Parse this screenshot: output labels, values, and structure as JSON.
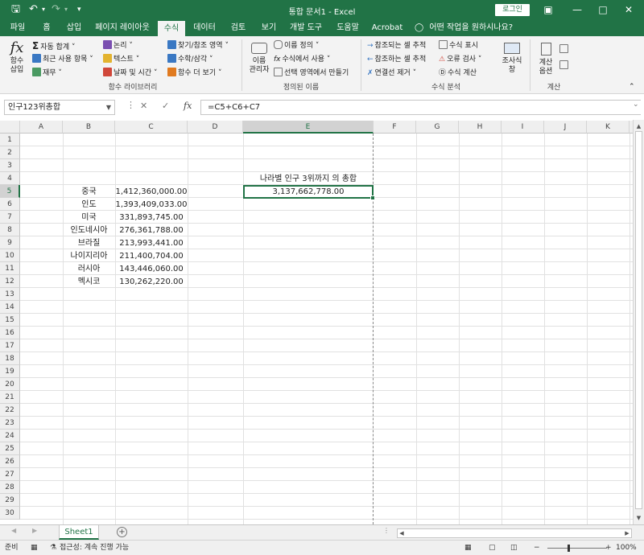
{
  "titlebar": {
    "save_icon": "save-icon",
    "undo_icon": "undo-icon",
    "redo_icon": "redo-icon",
    "title": "통합 문서1  -  Excel",
    "login_label": "로그인"
  },
  "tabs": [
    "파일",
    "홈",
    "삽입",
    "페이지 레이아웃",
    "수식",
    "데이터",
    "검토",
    "보기",
    "개발 도구",
    "도움말",
    "Acrobat"
  ],
  "active_tab": "수식",
  "help_text": "어떤 작업을 원하시나요?",
  "ribbon": {
    "insert_function": {
      "line1": "함수",
      "line2": "삽입"
    },
    "library": {
      "autosum": "자동 합계",
      "recent": "최근 사용 항목",
      "financial": "재무",
      "logical": "논리",
      "text": "텍스트",
      "datetime": "날짜 및 시간",
      "lookup": "찾기/참조 영역",
      "math": "수학/삼각",
      "more": "함수 더 보기",
      "group_label": "함수 라이브러리"
    },
    "names": {
      "manager_line1": "이름",
      "manager_line2": "관리자",
      "define": "이름 정의",
      "use": "수식에서 사용",
      "create": "선택 영역에서 만들기",
      "group_label": "정의된 이름"
    },
    "audit": {
      "precedents": "참조되는 셀 추적",
      "dependents": "참조하는 셀 추적",
      "remove": "연결선 제거",
      "show": "수식 표시",
      "error": "오류 검사",
      "evaluate": "수식 계산",
      "watch_line1": "조사식",
      "watch_line2": "창",
      "group_label": "수식 분석"
    },
    "calc": {
      "options_line1": "계산",
      "options_line2": "옵션",
      "group_label": "계산"
    }
  },
  "formula_bar": {
    "name_box": "인구123위총합",
    "formula": "=C5+C6+C7"
  },
  "columns": [
    "A",
    "B",
    "C",
    "D",
    "E",
    "F",
    "G",
    "H",
    "I",
    "J",
    "K"
  ],
  "selected_column": "E",
  "selected_row": 5,
  "rows": [
    "1",
    "2",
    "3",
    "4",
    "5",
    "6",
    "7",
    "8",
    "9",
    "10",
    "11",
    "12",
    "13",
    "14",
    "15",
    "16",
    "17",
    "18",
    "19",
    "20",
    "21",
    "22",
    "23",
    "24",
    "25",
    "26",
    "27",
    "28",
    "29",
    "30"
  ],
  "table": {
    "countries": [
      "중국",
      "인도",
      "미국",
      "인도네시아",
      "브라질",
      "나이지리아",
      "러시아",
      "멕시코"
    ],
    "populations": [
      "1,412,360,000.00",
      "1,393,409,033.00",
      "331,893,745.00",
      "276,361,788.00",
      "213,993,441.00",
      "211,400,704.00",
      "143,446,060.00",
      "130,262,220.00"
    ]
  },
  "summary": {
    "label": "나라별 인구 3위까지 의 총합",
    "value": "3,137,662,778.00"
  },
  "sheet": {
    "tab": "Sheet1"
  },
  "status": {
    "ready": "준비",
    "accessibility": "접근성: 계속 진행 가능",
    "zoom": "100%"
  },
  "colors": {
    "accent": "#217346"
  }
}
